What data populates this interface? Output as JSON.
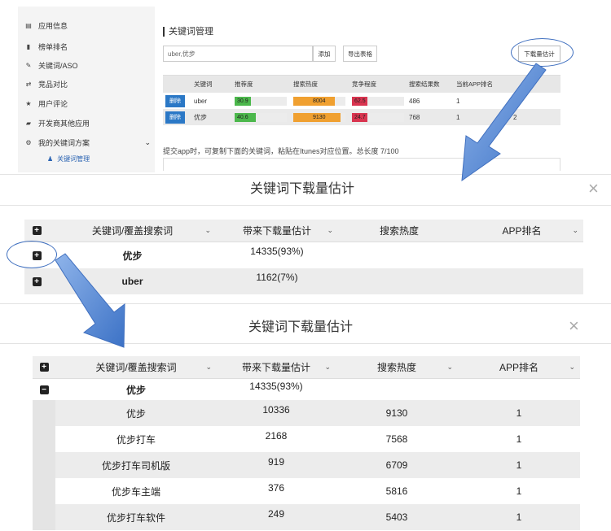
{
  "sidebar": {
    "items": [
      {
        "icon": "info-icon",
        "glyph": "▤",
        "label": "应用信息"
      },
      {
        "icon": "bar-chart-icon",
        "glyph": "▮",
        "label": "榜单排名"
      },
      {
        "icon": "edit-icon",
        "glyph": "✎",
        "label": "关键词/ASO"
      },
      {
        "icon": "compare-icon",
        "glyph": "⇄",
        "label": "竞品对比"
      },
      {
        "icon": "star-icon",
        "glyph": "★",
        "label": "用户评论"
      },
      {
        "icon": "book-icon",
        "glyph": "▰",
        "label": "开发商其他应用"
      },
      {
        "icon": "gear-icon",
        "glyph": "⚙",
        "label": "我的关键词方案"
      }
    ],
    "sub_item": {
      "icon": "user-icon",
      "glyph": "♟",
      "label": "关键词管理"
    }
  },
  "keyword_manager": {
    "title": "关键词管理",
    "input_value": "uber,优步",
    "add_button": "添加",
    "export_button": "导出表格",
    "estimate_button": "下载量估计",
    "columns": [
      "关键词",
      "推荐度",
      "搜索热度",
      "竞争程度",
      "搜索结果数",
      "当前APP排名"
    ],
    "rows": [
      {
        "delete": "删除",
        "keyword": "uber",
        "recommend": "30.9",
        "recommend_pct": 0.31,
        "heat": "8004",
        "heat_pct": 0.8,
        "competition": "62.5",
        "competition_pct": 0.3,
        "results": "486",
        "rank": "1",
        "extra": ""
      },
      {
        "delete": "删除",
        "keyword": "优步",
        "recommend": "40.6",
        "recommend_pct": 0.41,
        "heat": "9130",
        "heat_pct": 0.91,
        "competition": "24.7",
        "competition_pct": 0.3,
        "results": "768",
        "rank": "1",
        "extra": "2"
      }
    ],
    "hint": "提交app时，可复制下面的关键词，粘贴在Itunes对应位置。总长度 7/100"
  },
  "dialog1": {
    "title": "关键词下载量估计",
    "close": "×",
    "columns": [
      "关键词/覆盖搜索词",
      "带来下载量估计",
      "搜索热度",
      "APP排名"
    ],
    "rows": [
      {
        "toggle": "+",
        "keyword": "优步",
        "downloads": "14335(93%)"
      },
      {
        "toggle": "+",
        "keyword": "uber",
        "downloads": "1162(7%)"
      }
    ]
  },
  "dialog2": {
    "title": "关键词下载量估计",
    "close": "×",
    "columns": [
      "关键词/覆盖搜索词",
      "带来下载量估计",
      "搜索热度",
      "APP排名"
    ],
    "group": {
      "toggle": "−",
      "keyword": "优步",
      "downloads": "14335(93%)"
    },
    "rows": [
      {
        "keyword": "优步",
        "downloads": "10336",
        "heat": "9130",
        "rank": "1"
      },
      {
        "keyword": "优步打车",
        "downloads": "2168",
        "heat": "7568",
        "rank": "1"
      },
      {
        "keyword": "优步打车司机版",
        "downloads": "919",
        "heat": "6709",
        "rank": "1"
      },
      {
        "keyword": "优步车主端",
        "downloads": "376",
        "heat": "5816",
        "rank": "1"
      },
      {
        "keyword": "优步打车软件",
        "downloads": "249",
        "heat": "5403",
        "rank": "1"
      }
    ]
  },
  "colors": {
    "accent": "#2b78c6",
    "green": "#4cb84c",
    "orange": "#f0a030",
    "red": "#d9344f",
    "arrow": "#5b8fd6"
  }
}
